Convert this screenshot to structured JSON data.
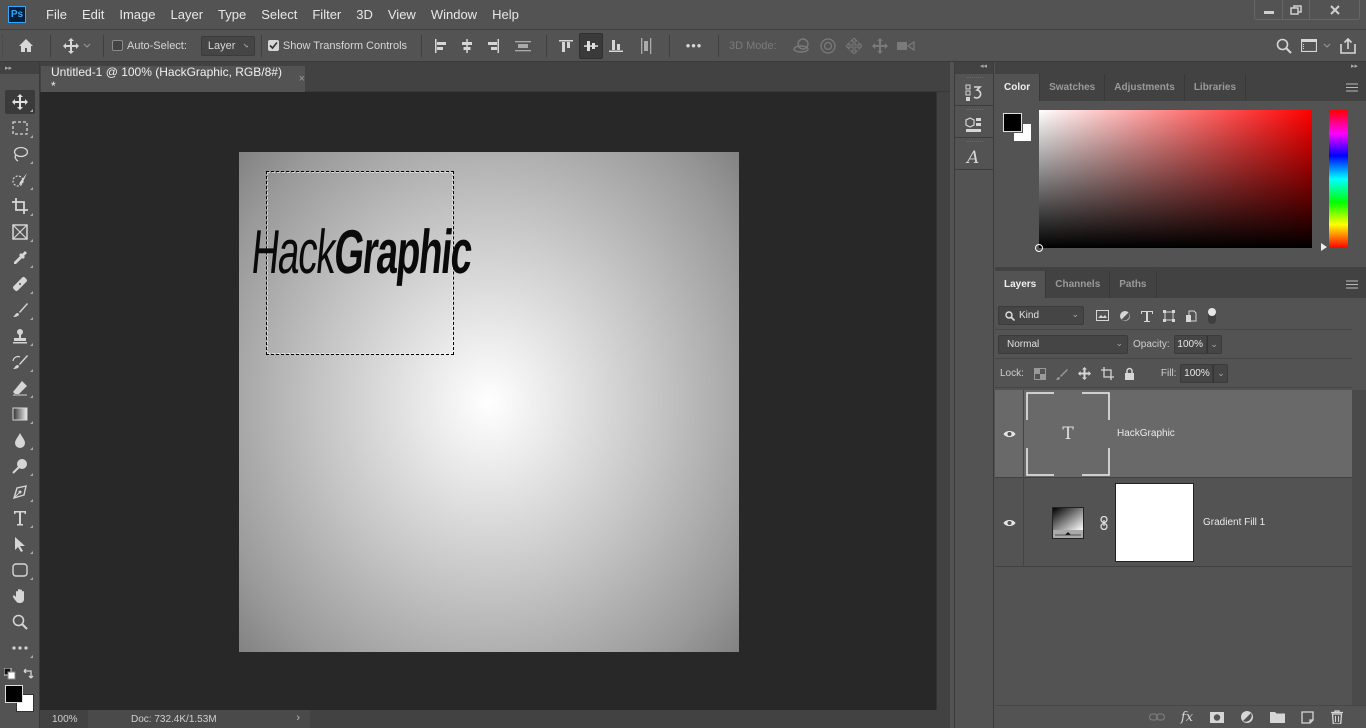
{
  "app": {
    "logo": "Ps",
    "menu": [
      "File",
      "Edit",
      "Image",
      "Layer",
      "Type",
      "Select",
      "Filter",
      "3D",
      "View",
      "Window",
      "Help"
    ],
    "window_controls": [
      "minimize-icon",
      "restore-icon",
      "close-icon"
    ]
  },
  "options_bar": {
    "auto_select_label": "Auto-Select:",
    "auto_select_checked": false,
    "auto_select_target": "Layer",
    "show_transform_label": "Show Transform Controls",
    "show_transform_checked": true,
    "three_d_mode_label": "3D Mode:",
    "more_label": "•••"
  },
  "document": {
    "tab_title": "Untitled-1 @ 100% (HackGraphic, RGB/8#) *",
    "close_glyph": "×",
    "canvas_text_thin": "Hack",
    "canvas_text_bold": "Graphic",
    "zoom": "100%",
    "doc_info": "Doc: 732.4K/1.53M",
    "status_arrow": "›"
  },
  "tools": [
    "move-tool",
    "marquee-tool",
    "lasso-tool",
    "quick-selection-tool",
    "crop-tool",
    "frame-tool",
    "eyedropper-tool",
    "healing-brush-tool",
    "brush-tool",
    "clone-stamp-tool",
    "history-brush-tool",
    "eraser-tool",
    "gradient-tool",
    "blur-tool",
    "dodge-tool",
    "pen-tool",
    "type-tool",
    "path-selection-tool",
    "rectangle-tool",
    "hand-tool",
    "zoom-tool",
    "edit-toolbar"
  ],
  "colors": {
    "foreground": "#000000",
    "background": "#ffffff",
    "accent_logo": "#31a8ff"
  },
  "color_panel": {
    "tabs": [
      {
        "label": "Color",
        "active": true
      },
      {
        "label": "Swatches",
        "active": false
      },
      {
        "label": "Adjustments",
        "active": false
      },
      {
        "label": "Libraries",
        "active": false
      }
    ]
  },
  "layers_panel": {
    "tabs": [
      {
        "label": "Layers",
        "active": true
      },
      {
        "label": "Channels",
        "active": false
      },
      {
        "label": "Paths",
        "active": false
      }
    ],
    "filter_kind": "Kind",
    "blend_mode": "Normal",
    "opacity_label": "Opacity:",
    "opacity_value": "100%",
    "lock_label": "Lock:",
    "fill_label": "Fill:",
    "fill_value": "100%",
    "layers": [
      {
        "name": "HackGraphic",
        "type": "text",
        "visible": true,
        "selected": true,
        "thumb_glyph": "T"
      },
      {
        "name": "Gradient Fill 1",
        "type": "fill",
        "visible": true,
        "selected": false
      }
    ]
  }
}
